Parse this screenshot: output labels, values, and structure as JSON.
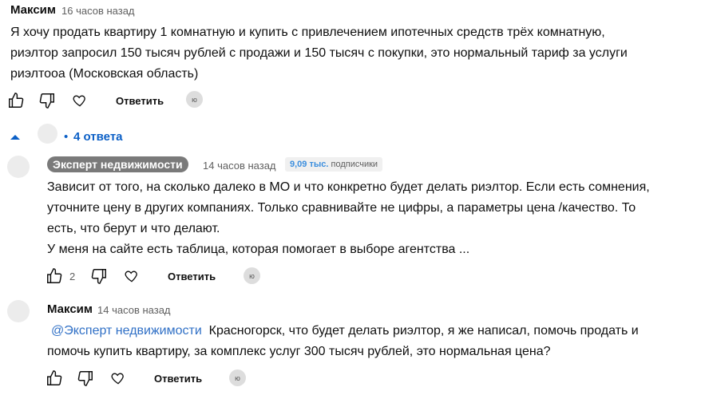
{
  "comment1": {
    "author": "Максим",
    "time": "16 часов назад",
    "lines": [
      "Я хочу продать квартиру 1 комнатную и купить с привлечением ипотечных средств трёх комнатную,",
      "риэлтор запросил 150 тысяч рублей с продажи и 150 тысяч с  покупки, это нормальный тариф за услуги",
      "риэлтооа (Московская область)"
    ],
    "reply_label": "Ответить",
    "avatar_mark": "ю"
  },
  "replies_toggle": {
    "label": "4 ответа"
  },
  "reply1": {
    "author": "Эксперт недвижимости",
    "time": "14 часов назад",
    "subscribers": {
      "count": "9,09 тыс.",
      "label": "подписчики"
    },
    "lines": [
      "Зависит от того, на сколько далеко в МО и что конкретно будет делать риэлтор. Если есть сомнения,",
      "уточните цену в других компаниях. Только сравнивайте не цифры, а параметры цена /качество. То",
      "есть, что берут и что делают.",
      "У меня на сайте есть таблица, которая помогает в выборе агентства ..."
    ],
    "likes": "2",
    "reply_label": "Ответить",
    "avatar_mark": "ю"
  },
  "reply2": {
    "author": "Максим",
    "time": "14 часов назад",
    "mention": "@Эксперт недвижимости",
    "line1_rest": "  Красногорск, что будет делать риэлтор, я же написал, помочь продать и",
    "line2": "помочь купить квартиру, за комплекс услуг 300 тысяч рублей, это нормальная цена?",
    "reply_label": "Ответить",
    "avatar_mark": "ю"
  }
}
